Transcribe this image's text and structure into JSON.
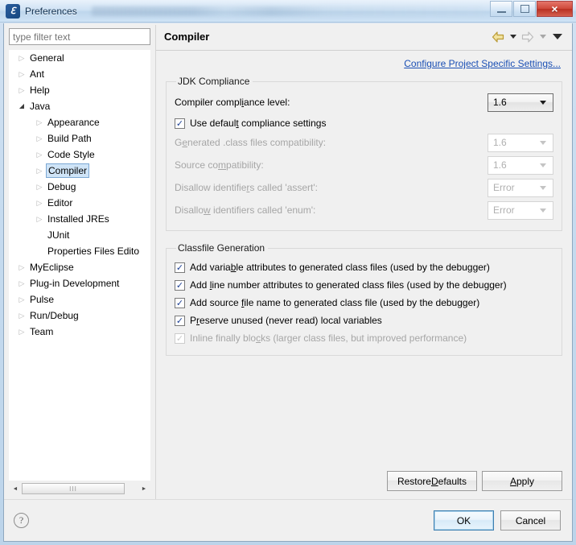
{
  "window": {
    "title": "Preferences",
    "icon": "eclipse-icon",
    "minimize_label": "minimize-icon",
    "maximize_label": "maximize-icon",
    "close_label": "×"
  },
  "sidebar": {
    "filter_placeholder": "type filter text",
    "filter_value": "",
    "items": [
      {
        "label": "General",
        "level": 1,
        "twisty": "collapsed",
        "selected": false
      },
      {
        "label": "Ant",
        "level": 1,
        "twisty": "collapsed",
        "selected": false
      },
      {
        "label": "Help",
        "level": 1,
        "twisty": "collapsed",
        "selected": false
      },
      {
        "label": "Java",
        "level": 1,
        "twisty": "expanded",
        "selected": false
      },
      {
        "label": "Appearance",
        "level": 2,
        "twisty": "collapsed",
        "selected": false
      },
      {
        "label": "Build Path",
        "level": 2,
        "twisty": "collapsed",
        "selected": false
      },
      {
        "label": "Code Style",
        "level": 2,
        "twisty": "collapsed",
        "selected": false
      },
      {
        "label": "Compiler",
        "level": 2,
        "twisty": "collapsed",
        "selected": true
      },
      {
        "label": "Debug",
        "level": 2,
        "twisty": "collapsed",
        "selected": false
      },
      {
        "label": "Editor",
        "level": 2,
        "twisty": "collapsed",
        "selected": false
      },
      {
        "label": "Installed JREs",
        "level": 2,
        "twisty": "collapsed",
        "selected": false
      },
      {
        "label": "JUnit",
        "level": 2,
        "twisty": "none",
        "selected": false
      },
      {
        "label": "Properties Files Edito",
        "level": 2,
        "twisty": "none",
        "selected": false
      },
      {
        "label": "MyEclipse",
        "level": 1,
        "twisty": "collapsed",
        "selected": false
      },
      {
        "label": "Plug-in Development",
        "level": 1,
        "twisty": "collapsed",
        "selected": false
      },
      {
        "label": "Pulse",
        "level": 1,
        "twisty": "collapsed",
        "selected": false
      },
      {
        "label": "Run/Debug",
        "level": 1,
        "twisty": "collapsed",
        "selected": false
      },
      {
        "label": "Team",
        "level": 1,
        "twisty": "collapsed",
        "selected": false
      }
    ],
    "scrollbar": {
      "left_arrow": "◄",
      "right_arrow": "►",
      "grip": "III"
    }
  },
  "page": {
    "title": "Compiler",
    "toolbar": {
      "back_icon": "back-arrow-icon",
      "back_menu_icon": "chevron-down-icon",
      "forward_icon": "forward-arrow-icon",
      "forward_menu_icon": "chevron-down-icon",
      "menu_icon": "chevron-down-icon"
    },
    "project_settings_link": "Configure Project Specific Settings...",
    "groups": [
      {
        "legend": "JDK Compliance",
        "compliance_label_pre": "Compiler compl",
        "compliance_label_mnemonic": "i",
        "compliance_label_post": "ance level:",
        "compliance_value": "1.6",
        "use_default_pre": "Use defaul",
        "use_default_mnemonic": "t",
        "use_default_post": " compliance settings",
        "use_default_checked": "✓",
        "rows": [
          {
            "label_pre": "G",
            "label_mnemonic": "e",
            "label_post": "nerated .class files compatibility:",
            "value": "1.6",
            "disabled": true
          },
          {
            "label_pre": "Source co",
            "label_mnemonic": "m",
            "label_post": "patibility:",
            "value": "1.6",
            "disabled": true
          },
          {
            "label_pre": "Disallow identifie",
            "label_mnemonic": "r",
            "label_post": "s called 'assert':",
            "value": "Error",
            "disabled": true
          },
          {
            "label_pre": "Disallo",
            "label_mnemonic": "w",
            "label_post": " identifiers called 'enum':",
            "value": "Error",
            "disabled": true
          }
        ]
      },
      {
        "legend": "Classfile Generation",
        "checks": [
          {
            "pre": "Add varia",
            "mnemonic": "b",
            "post": "le attributes to generated class files (used by the debugger)",
            "checked": "✓",
            "disabled": false
          },
          {
            "pre": "Add ",
            "mnemonic": "l",
            "post": "ine number attributes to generated class files (used by the debugger)",
            "checked": "✓",
            "disabled": false
          },
          {
            "pre": "Add source ",
            "mnemonic": "f",
            "post": "ile name to generated class file (used by the debugger)",
            "checked": "✓",
            "disabled": false
          },
          {
            "pre": "P",
            "mnemonic": "r",
            "post": "eserve unused (never read) local variables",
            "checked": "✓",
            "disabled": false
          },
          {
            "pre": "Inline finally blo",
            "mnemonic": "c",
            "post": "ks (larger class files, but improved performance)",
            "checked": "✓",
            "disabled": true
          }
        ]
      }
    ]
  },
  "buttons": {
    "restore_defaults_pre": "Restore ",
    "restore_defaults_mnemonic": "D",
    "restore_defaults_post": "efaults",
    "apply_mnemonic": "A",
    "apply_post": "pply",
    "ok": "OK",
    "cancel": "Cancel",
    "help_icon": "?"
  },
  "colors": {
    "accent_link": "#1a4fb4",
    "selection": "#cfe4f7",
    "selection_border": "#7ca8d4",
    "panel_bg": "#f0f0f0",
    "close_button": "#cf4b3c",
    "back_arrow": "#e8d27a"
  }
}
